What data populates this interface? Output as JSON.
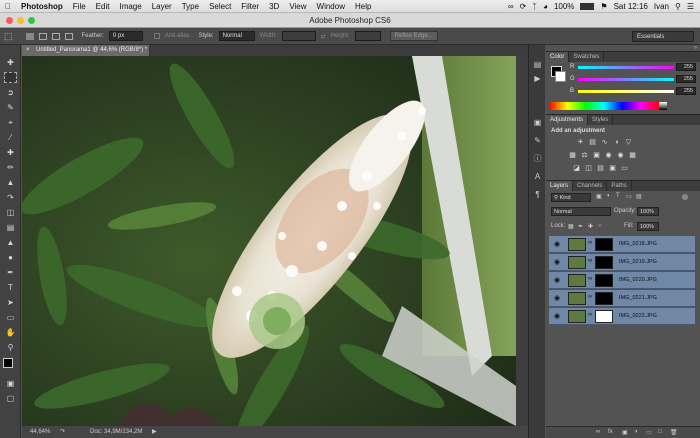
{
  "menubar": {
    "app": "Photoshop",
    "items": [
      "File",
      "Edit",
      "Image",
      "Layer",
      "Type",
      "Select",
      "Filter",
      "3D",
      "View",
      "Window",
      "Help"
    ],
    "battery": "100%",
    "clock": "Sat 12:16",
    "user": "Ivan"
  },
  "window": {
    "title": "Adobe Photoshop CS6"
  },
  "options": {
    "feather_label": "Feather:",
    "feather_value": "0 px",
    "antialias_label": "Anti-alias",
    "style_label": "Style:",
    "style_value": "Normal",
    "width_label": "Width:",
    "height_label": "Height:",
    "refine_edge": "Refine Edge...",
    "workspace": "Essentials"
  },
  "document": {
    "tab_title": "Untitled_Panorama1 @ 44,6% (RGB/8*) *",
    "zoom": "44,64%",
    "doc_size": "Doc: 34,9M/234,2M"
  },
  "color_panel": {
    "tabs": [
      "Color",
      "Swatches"
    ],
    "rows": [
      {
        "label": "R",
        "value": "255",
        "color": "#e040e0"
      },
      {
        "label": "G",
        "value": "255",
        "color": "#40d8e0"
      },
      {
        "label": "B",
        "value": "255",
        "color": "#e8e040"
      }
    ]
  },
  "adjustments_panel": {
    "tabs": [
      "Adjustments",
      "Styles"
    ],
    "heading": "Add an adjustment"
  },
  "layers_panel": {
    "tabs": [
      "Layers",
      "Channels",
      "Paths"
    ],
    "filter": "Kind",
    "blend_mode": "Normal",
    "opacity_label": "Opacity:",
    "opacity_value": "100%",
    "lock_label": "Lock:",
    "fill_label": "Fill:",
    "fill_value": "100%",
    "layers": [
      {
        "name": "IMG_0218.JPG"
      },
      {
        "name": "IMG_0219.JPG"
      },
      {
        "name": "IMG_0220.JPG"
      },
      {
        "name": "IMG_0221.JPG"
      },
      {
        "name": "IMG_0222.JPG"
      }
    ]
  }
}
